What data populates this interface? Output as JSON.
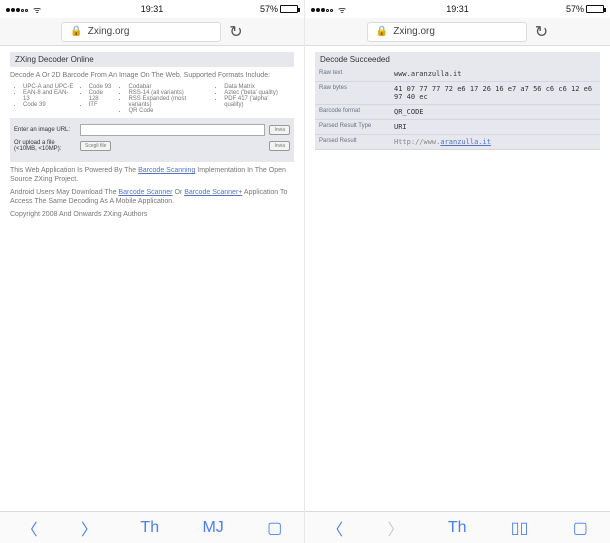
{
  "status": {
    "time": "19:31",
    "battery": "57%"
  },
  "address": "Zxing.org",
  "left": {
    "panel_title": "ZXing Decoder Online",
    "desc": "Decode A Or 2D Barcode From An Image On The Web. Supported Formats Include:",
    "col1_1": "UPC-A and UPC-E",
    "col1_2": "EAN-8 and EAN-13",
    "col1_3": "Code 39",
    "col2_1": "Code 93",
    "col2_2": "Code 128",
    "col2_3": "ITF",
    "col3_1": "Codabar",
    "col3_2": "RSS-14 (all variants)",
    "col3_3": "RSS Expanded (most variants)",
    "col3_4": "QR Code",
    "col4_1": "Data Matrix",
    "col4_2": "Aztec ('beta' quality)",
    "col4_3": "PDF 417 ('alpha' quality)",
    "url_label": "Enter an image URL:",
    "file_label": "Or upload a file (<10MB, <10MP):",
    "choose": "Scegli file",
    "submit": "Invia",
    "para1a": "This Web Application Is Powered By The ",
    "para1b": "Barcode Scanning",
    "para1c": " Implementation In The Open Source ZXing Project.",
    "para2a": "Android Users May Download The ",
    "para2b": "Barcode Scanner",
    "para2c": " Or ",
    "para2d": "Barcode Scanner+",
    "para2e": " Application To Access The Same Decoding As A Mobile Application.",
    "copy": "Copyright 2008 And Onwards ZXing Authors"
  },
  "right": {
    "header": "Decode Succeeded",
    "k1": "Raw text",
    "v1": "www.aranzulla.it",
    "k2": "Raw bytes",
    "v2": "41 07 77 77 72 e6 17 26  16 e7 a7 56 c6 c6 12 e6  97 40 ec",
    "k3": "Barcode format",
    "v3": "QR_CODE",
    "k4": "Parsed Result Type",
    "v4": "URI",
    "k5": "Parsed Result",
    "v5_prefix": "Http://www.",
    "v5_link": "aranzulla.it"
  },
  "toolbar": {
    "share": "Th",
    "book": "MJ"
  }
}
